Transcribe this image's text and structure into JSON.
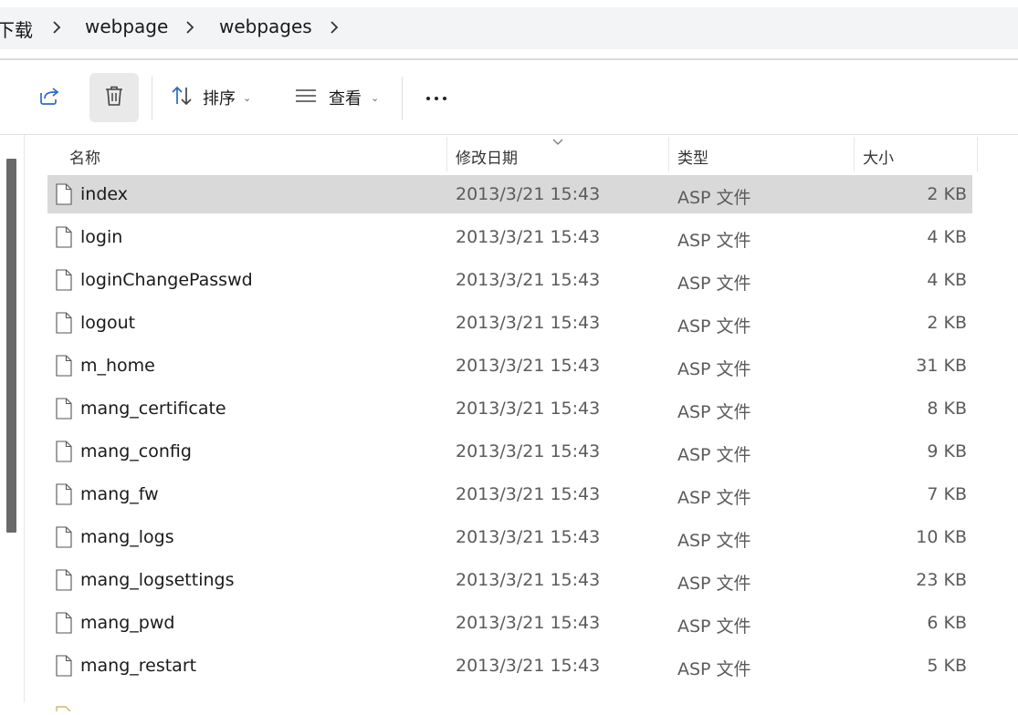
{
  "breadcrumb": {
    "items": [
      "下载",
      "webpage",
      "webpages"
    ]
  },
  "toolbar": {
    "sort_label": "排序",
    "view_label": "查看"
  },
  "columns": {
    "name": "名称",
    "date": "修改日期",
    "type": "类型",
    "size": "大小"
  },
  "files": [
    {
      "name": "index",
      "date": "2013/3/21 15:43",
      "type": "ASP 文件",
      "size": "2 KB",
      "selected": true
    },
    {
      "name": "login",
      "date": "2013/3/21 15:43",
      "type": "ASP 文件",
      "size": "4 KB"
    },
    {
      "name": "loginChangePasswd",
      "date": "2013/3/21 15:43",
      "type": "ASP 文件",
      "size": "4 KB"
    },
    {
      "name": "logout",
      "date": "2013/3/21 15:43",
      "type": "ASP 文件",
      "size": "2 KB"
    },
    {
      "name": "m_home",
      "date": "2013/3/21 15:43",
      "type": "ASP 文件",
      "size": "31 KB"
    },
    {
      "name": "mang_certificate",
      "date": "2013/3/21 15:43",
      "type": "ASP 文件",
      "size": "8 KB"
    },
    {
      "name": "mang_config",
      "date": "2013/3/21 15:43",
      "type": "ASP 文件",
      "size": "9 KB"
    },
    {
      "name": "mang_fw",
      "date": "2013/3/21 15:43",
      "type": "ASP 文件",
      "size": "7 KB"
    },
    {
      "name": "mang_logs",
      "date": "2013/3/21 15:43",
      "type": "ASP 文件",
      "size": "10 KB"
    },
    {
      "name": "mang_logsettings",
      "date": "2013/3/21 15:43",
      "type": "ASP 文件",
      "size": "23 KB"
    },
    {
      "name": "mang_pwd",
      "date": "2013/3/21 15:43",
      "type": "ASP 文件",
      "size": "6 KB"
    },
    {
      "name": "mang_restart",
      "date": "2013/3/21 15:43",
      "type": "ASP 文件",
      "size": "5 KB"
    }
  ],
  "colors": {
    "selected_row": "#d9d9d9",
    "breadcrumb_bg": "#f3f4f6",
    "scroll_thumb": "#6a6a6a"
  },
  "icons": [
    "share-icon",
    "delete-icon",
    "sort-icon",
    "view-icon",
    "more-icon",
    "chevron-right-icon",
    "file-icon",
    "sort-descending-icon"
  ]
}
